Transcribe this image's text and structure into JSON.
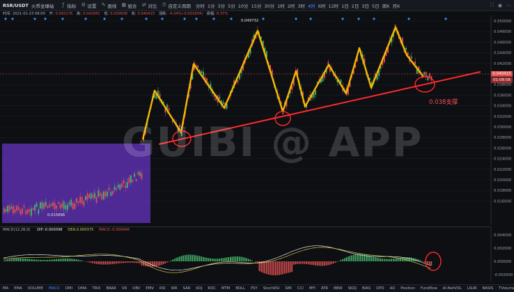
{
  "topbar": {
    "symbol": "RSR/USDT",
    "exchange": "火币全球站",
    "tools": [
      {
        "label": "指标",
        "icon": "indicator-icon"
      },
      {
        "label": "设置",
        "icon": "gear-icon"
      },
      {
        "label": "画线",
        "icon": "draw-icon"
      },
      {
        "label": "组合",
        "icon": "combo-icon"
      },
      {
        "label": "对比",
        "icon": "compare-icon"
      },
      {
        "label": "自定义周期",
        "icon": "custom-period-icon"
      }
    ],
    "timeframes": [
      "分时",
      "1分",
      "3分",
      "5分",
      "10分",
      "15分",
      "30分",
      "1时",
      "2时",
      "3时",
      "4时",
      "6时",
      "12时",
      "1日",
      "2日",
      "3日",
      "5日",
      "周K",
      "月K"
    ],
    "active_timeframe": "4时",
    "right_icons": [
      "fullscreen-icon",
      "camera-icon",
      "more-icon"
    ]
  },
  "ohlc": {
    "time_label": "时间:",
    "time": "2021-01-23 08:00",
    "open_label": "开:",
    "open": "0.042176",
    "high_label": "高:",
    "high": "0.042581",
    "low_label": "低:",
    "low": "0.039938",
    "close_label": "收:",
    "close": "0.040415",
    "change_label": "涨跌:",
    "change": "-4.34%(-0.001834)",
    "amp_label": "振幅:",
    "amp": "6.37%"
  },
  "price_axis": {
    "ticks": [
      "0.050000",
      "0.048000",
      "0.046000",
      "0.044000",
      "0.042000",
      "0.040000",
      "0.038000",
      "0.036000",
      "0.034000",
      "0.032000",
      "0.030000",
      "0.028000",
      "0.026000",
      "0.024000",
      "0.022000",
      "0.020000",
      "0.018000",
      "0.016000"
    ],
    "current_price": "0.040415",
    "countdown": "01:08:58",
    "high_marker": "0.049732",
    "low_marker": "0.015896"
  },
  "macd": {
    "title": "MACD(12,26,9)",
    "dif_label": "DIF:",
    "dif": "-0.000098",
    "dea_label": "DEA:",
    "dea": "0.000375",
    "macd_label": "MACD:",
    "macd": "-0.000946",
    "ticks": [
      "0.004000",
      "0.002000",
      "0.000000",
      "-0.002000"
    ]
  },
  "annotations": {
    "support_text": "0.038支撑",
    "watermark": "GUIBI @ APP"
  },
  "indicators": [
    "MA",
    "EMA",
    "VOLUME",
    "MACD",
    "DMI",
    "DMA",
    "TRIX",
    "BRAR",
    "VR",
    "OBV",
    "EMV",
    "RSI",
    "WR",
    "SAR",
    "KDJ",
    "ROC",
    "MTM",
    "BOLL",
    "PSY",
    "StochRSI",
    "SMI",
    "CCI",
    "MFI",
    "ATR",
    "BBW",
    "SKDJ",
    "BIAS",
    "DPO",
    "AO",
    "Position",
    "Fundflow",
    "AI-NetVOL",
    "LSUR",
    "BASIS",
    "TVolume",
    "FTBS",
    "TTSI",
    "TTMU"
  ],
  "active_indicator": "MACD",
  "colors": {
    "up": "#49b56a",
    "down": "#e05151",
    "accent": "#3d8bfd",
    "zigzag": "#f5b800",
    "trendline": "#ff2a2a",
    "overlay": "#6a34c8"
  }
}
